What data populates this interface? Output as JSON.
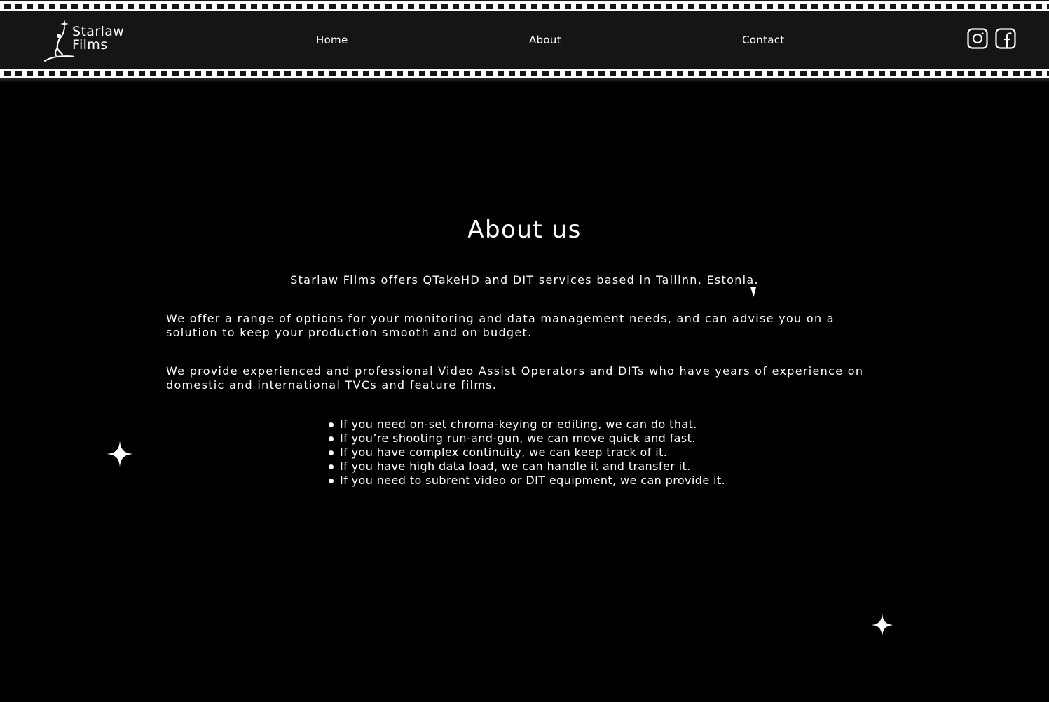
{
  "brand": {
    "line1": "Starlaw",
    "line2": "Films",
    "logo_icon": "star-figure-logo-icon"
  },
  "nav": {
    "items": [
      {
        "label": "Home"
      },
      {
        "label": "About"
      },
      {
        "label": "Contact"
      }
    ]
  },
  "social": {
    "icons": [
      "instagram-icon",
      "facebook-icon"
    ]
  },
  "colors": {
    "background": "#000000",
    "header": "#151515",
    "text": "#ffffff"
  },
  "main": {
    "title": "About us",
    "intro": "Starlaw Films offers QTakeHD and DIT services based in Tallinn, Estonia.",
    "paragraphs": [
      "We offer a range of options for your monitoring and data management needs, and can advise you on a solution to keep your production smooth and on budget.",
      "We provide experienced and professional Video Assist Operators and DITs who have years of experience on domestic and international TVCs and feature films."
    ],
    "bullets": [
      "If you need on-set chroma-keying or editing, we can do that.",
      "If you’re shooting run-and-gun, we can move quick and fast.",
      "If you have complex continuity, we can keep track of it.",
      "If you have high data load, we can handle it and transfer it.",
      "If you need to subrent video or DIT equipment, we can provide it."
    ]
  }
}
